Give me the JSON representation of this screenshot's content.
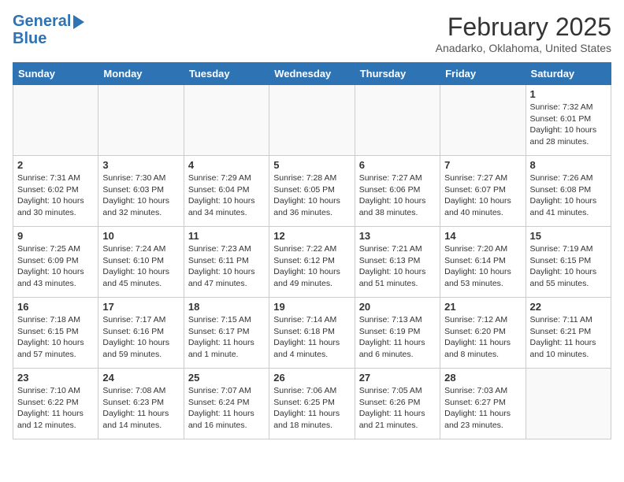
{
  "header": {
    "logo_line1": "General",
    "logo_line2": "Blue",
    "title": "February 2025",
    "subtitle": "Anadarko, Oklahoma, United States"
  },
  "weekdays": [
    "Sunday",
    "Monday",
    "Tuesday",
    "Wednesday",
    "Thursday",
    "Friday",
    "Saturday"
  ],
  "weeks": [
    [
      {
        "day": "",
        "info": ""
      },
      {
        "day": "",
        "info": ""
      },
      {
        "day": "",
        "info": ""
      },
      {
        "day": "",
        "info": ""
      },
      {
        "day": "",
        "info": ""
      },
      {
        "day": "",
        "info": ""
      },
      {
        "day": "1",
        "info": "Sunrise: 7:32 AM\nSunset: 6:01 PM\nDaylight: 10 hours and 28 minutes."
      }
    ],
    [
      {
        "day": "2",
        "info": "Sunrise: 7:31 AM\nSunset: 6:02 PM\nDaylight: 10 hours and 30 minutes."
      },
      {
        "day": "3",
        "info": "Sunrise: 7:30 AM\nSunset: 6:03 PM\nDaylight: 10 hours and 32 minutes."
      },
      {
        "day": "4",
        "info": "Sunrise: 7:29 AM\nSunset: 6:04 PM\nDaylight: 10 hours and 34 minutes."
      },
      {
        "day": "5",
        "info": "Sunrise: 7:28 AM\nSunset: 6:05 PM\nDaylight: 10 hours and 36 minutes."
      },
      {
        "day": "6",
        "info": "Sunrise: 7:27 AM\nSunset: 6:06 PM\nDaylight: 10 hours and 38 minutes."
      },
      {
        "day": "7",
        "info": "Sunrise: 7:27 AM\nSunset: 6:07 PM\nDaylight: 10 hours and 40 minutes."
      },
      {
        "day": "8",
        "info": "Sunrise: 7:26 AM\nSunset: 6:08 PM\nDaylight: 10 hours and 41 minutes."
      }
    ],
    [
      {
        "day": "9",
        "info": "Sunrise: 7:25 AM\nSunset: 6:09 PM\nDaylight: 10 hours and 43 minutes."
      },
      {
        "day": "10",
        "info": "Sunrise: 7:24 AM\nSunset: 6:10 PM\nDaylight: 10 hours and 45 minutes."
      },
      {
        "day": "11",
        "info": "Sunrise: 7:23 AM\nSunset: 6:11 PM\nDaylight: 10 hours and 47 minutes."
      },
      {
        "day": "12",
        "info": "Sunrise: 7:22 AM\nSunset: 6:12 PM\nDaylight: 10 hours and 49 minutes."
      },
      {
        "day": "13",
        "info": "Sunrise: 7:21 AM\nSunset: 6:13 PM\nDaylight: 10 hours and 51 minutes."
      },
      {
        "day": "14",
        "info": "Sunrise: 7:20 AM\nSunset: 6:14 PM\nDaylight: 10 hours and 53 minutes."
      },
      {
        "day": "15",
        "info": "Sunrise: 7:19 AM\nSunset: 6:15 PM\nDaylight: 10 hours and 55 minutes."
      }
    ],
    [
      {
        "day": "16",
        "info": "Sunrise: 7:18 AM\nSunset: 6:15 PM\nDaylight: 10 hours and 57 minutes."
      },
      {
        "day": "17",
        "info": "Sunrise: 7:17 AM\nSunset: 6:16 PM\nDaylight: 10 hours and 59 minutes."
      },
      {
        "day": "18",
        "info": "Sunrise: 7:15 AM\nSunset: 6:17 PM\nDaylight: 11 hours and 1 minute."
      },
      {
        "day": "19",
        "info": "Sunrise: 7:14 AM\nSunset: 6:18 PM\nDaylight: 11 hours and 4 minutes."
      },
      {
        "day": "20",
        "info": "Sunrise: 7:13 AM\nSunset: 6:19 PM\nDaylight: 11 hours and 6 minutes."
      },
      {
        "day": "21",
        "info": "Sunrise: 7:12 AM\nSunset: 6:20 PM\nDaylight: 11 hours and 8 minutes."
      },
      {
        "day": "22",
        "info": "Sunrise: 7:11 AM\nSunset: 6:21 PM\nDaylight: 11 hours and 10 minutes."
      }
    ],
    [
      {
        "day": "23",
        "info": "Sunrise: 7:10 AM\nSunset: 6:22 PM\nDaylight: 11 hours and 12 minutes."
      },
      {
        "day": "24",
        "info": "Sunrise: 7:08 AM\nSunset: 6:23 PM\nDaylight: 11 hours and 14 minutes."
      },
      {
        "day": "25",
        "info": "Sunrise: 7:07 AM\nSunset: 6:24 PM\nDaylight: 11 hours and 16 minutes."
      },
      {
        "day": "26",
        "info": "Sunrise: 7:06 AM\nSunset: 6:25 PM\nDaylight: 11 hours and 18 minutes."
      },
      {
        "day": "27",
        "info": "Sunrise: 7:05 AM\nSunset: 6:26 PM\nDaylight: 11 hours and 21 minutes."
      },
      {
        "day": "28",
        "info": "Sunrise: 7:03 AM\nSunset: 6:27 PM\nDaylight: 11 hours and 23 minutes."
      },
      {
        "day": "",
        "info": ""
      }
    ]
  ]
}
